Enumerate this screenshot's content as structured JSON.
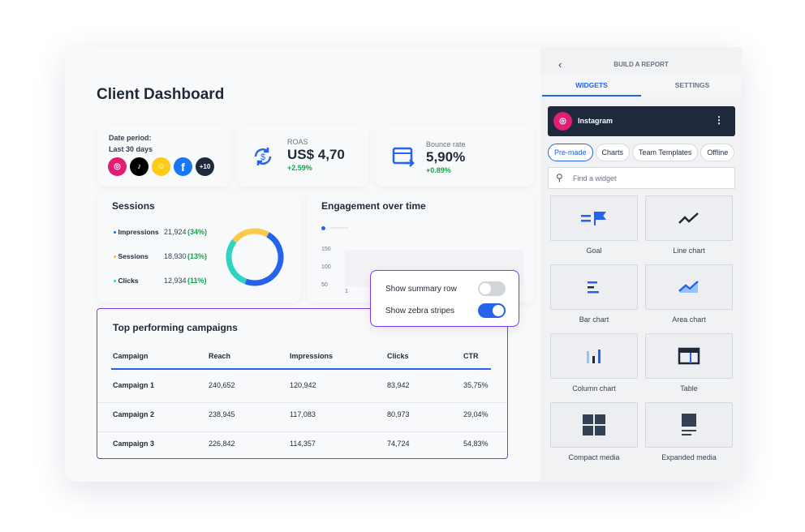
{
  "dashboard": {
    "title": "Client Dashboard",
    "date": {
      "label": "Date period:",
      "value": "Last 30 days",
      "more": "+10"
    },
    "roas": {
      "label": "ROAS",
      "value": "US$ 4,70",
      "change": "+2.59%"
    },
    "bounce": {
      "label": "Bounce rate",
      "value": "5,90%",
      "change": "+0.89%"
    },
    "sessions": {
      "title": "Sessions",
      "items": [
        {
          "label": "Impressions",
          "value": "21,924",
          "pct": "(34%)",
          "color": "#2563eb"
        },
        {
          "label": "Sessions",
          "value": "18,930",
          "pct": "(13%)",
          "color": "#fbbf24"
        },
        {
          "label": "Clicks",
          "value": "12,934",
          "pct": "(11%)",
          "color": "#2dd4bf"
        }
      ]
    },
    "engagement": {
      "title": "Engagement over time",
      "yticks": [
        "150",
        "100",
        "50"
      ],
      "xtick": "1"
    },
    "popup": {
      "summary": "Show summary row",
      "summary_on": false,
      "zebra": "Show zebra stripes",
      "zebra_on": true
    },
    "table": {
      "title": "Top performing campaigns",
      "headers": [
        "Campaign",
        "Reach",
        "Impressions",
        "Clicks",
        "CTR"
      ],
      "rows": [
        [
          "Campaign 1",
          "240,652",
          "120,942",
          "83,942",
          "35,75%"
        ],
        [
          "Campaign 2",
          "238,945",
          "117,083",
          "80,973",
          "29,04%"
        ],
        [
          "Campaign 3",
          "226,842",
          "114,357",
          "74,724",
          "54,83%"
        ]
      ]
    }
  },
  "panel": {
    "title": "BUILD A REPORT",
    "tabs": [
      "WIDGETS",
      "SETTINGS"
    ],
    "source": "Instagram",
    "chips": [
      "Pre-made",
      "Charts",
      "Team Templates",
      "Offline"
    ],
    "search_placeholder": "Find a widget",
    "widgets": [
      "Goal",
      "Line chart",
      "Bar chart",
      "Area chart",
      "Column chart",
      "Table",
      "Compact media",
      "Expanded media"
    ]
  },
  "colors": {
    "accent": "#2563eb",
    "highlight": "#7c3aed",
    "dark": "#1e293b"
  }
}
